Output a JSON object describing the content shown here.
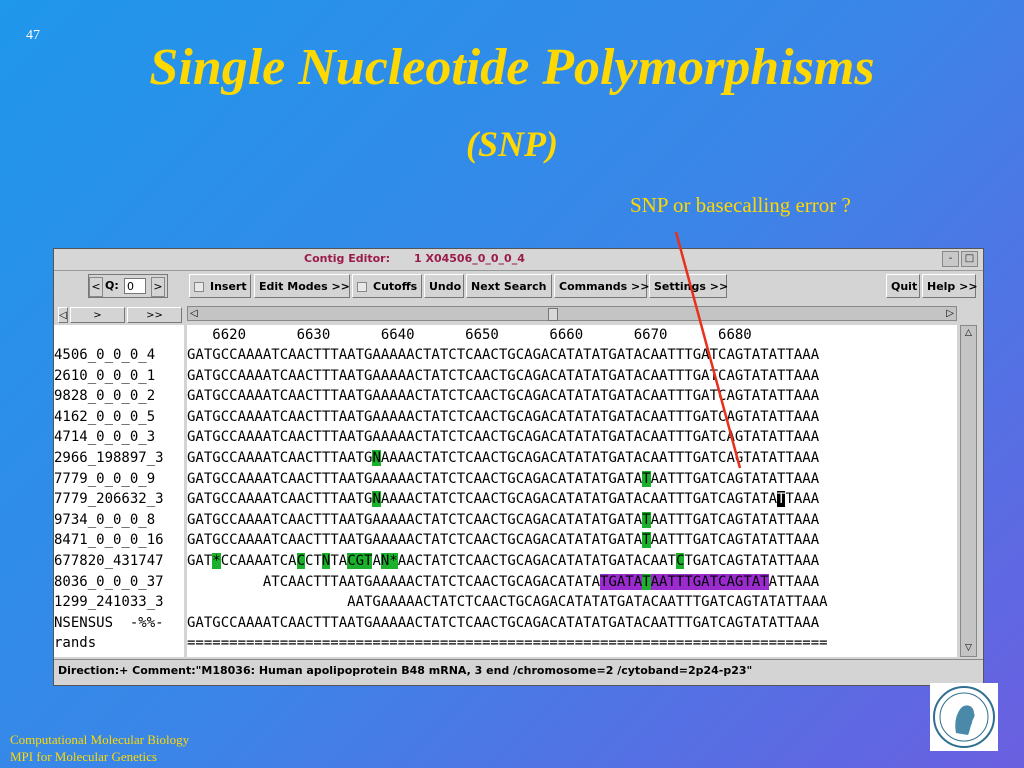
{
  "slide": {
    "number": "47",
    "title": "Single Nucleotide Polymorphisms",
    "subtitle": "(SNP)",
    "annotation": "SNP or basecalling error ?",
    "footer_line1": "Computational Molecular Biology",
    "footer_line2": "MPI for Molecular Genetics",
    "logo_icon": "minerva-head-logo-icon",
    "title_color": "#ffd800",
    "annotation_arrow_color": "#e8301c"
  },
  "window": {
    "title_label": "Contig Editor:",
    "title_name": "1 X04506_0_0_0_4",
    "minimize": "-",
    "close": "□"
  },
  "toolbar": {
    "q_left": "<",
    "q_label": "Q:",
    "q_value": "0",
    "q_right": ">",
    "insert": "Insert",
    "edit_modes": "Edit Modes >>",
    "cutoffs": "Cutoffs",
    "undo": "Undo",
    "next_search": "Next Search",
    "commands": "Commands >>",
    "settings": "Settings >>",
    "quit": "Quit",
    "help": "Help >>"
  },
  "nav": {
    "fwd": ">",
    "ffwd": ">>",
    "back": "◁",
    "left_arrow": "◁",
    "right_arrow": "▷"
  },
  "ruler": "   6620      6630      6640      6650      6660      6670      6680",
  "reads": [
    {
      "name": "4506_0_0_0_4",
      "seq": [
        {
          "t": "GATGCCAAAATCAACTTTAATGAAAAACTATCTCAACTGCAGACATATATGATACAATTTGATCAGTATATTAAA"
        }
      ]
    },
    {
      "name": "2610_0_0_0_1",
      "seq": [
        {
          "t": "GATGCCAAAATCAACTTTAATGAAAAACTATCTCAACTGCAGACATATATGATACAATTTGATCAGTATATTAAA"
        }
      ]
    },
    {
      "name": "9828_0_0_0_2",
      "seq": [
        {
          "t": "GATGCCAAAATCAACTTTAATGAAAAACTATCTCAACTGCAGACATATATGATACAATTTGATCAGTATATTAAA"
        }
      ]
    },
    {
      "name": "4162_0_0_0_5",
      "seq": [
        {
          "t": "GATGCCAAAATCAACTTTAATGAAAAACTATCTCAACTGCAGACATATATGATACAATTTGATCAGTATATTAAA"
        }
      ]
    },
    {
      "name": "4714_0_0_0_3",
      "seq": [
        {
          "t": "GATGCCAAAATCAACTTTAATGAAAAACTATCTCAACTGCAGACATATATGATACAATTTGATCAGTATATTAAA"
        }
      ]
    },
    {
      "name": "2966_198897_3",
      "seq": [
        {
          "t": "GATGCCAAAATCAACTTTAATG"
        },
        {
          "t": "N",
          "h": "g"
        },
        {
          "t": "AAAACTATCTCAACTGCAGACATATATGATACAATTTGATCAGTATATTAAA"
        }
      ]
    },
    {
      "name": "7779_0_0_0_9",
      "seq": [
        {
          "t": "GATGCCAAAATCAACTTTAATGAAAAACTATCTCAACTGCAGACATATATGATA"
        },
        {
          "t": "T",
          "h": "g"
        },
        {
          "t": "AATTTGATCAGTATATTAAA"
        }
      ]
    },
    {
      "name": "7779_206632_3",
      "seq": [
        {
          "t": "GATGCCAAAATCAACTTTAATG"
        },
        {
          "t": "N",
          "h": "g"
        },
        {
          "t": "AAAACTATCTCAACTGCAGACATATATGATACAATTTGATCAGTATA"
        },
        {
          "t": "T",
          "h": "k"
        },
        {
          "t": "TAAA"
        }
      ]
    },
    {
      "name": "9734_0_0_0_8",
      "seq": [
        {
          "t": "GATGCCAAAATCAACTTTAATGAAAAACTATCTCAACTGCAGACATATATGATA"
        },
        {
          "t": "T",
          "h": "g"
        },
        {
          "t": "AATTTGATCAGTATATTAAA"
        }
      ]
    },
    {
      "name": "8471_0_0_0_16",
      "seq": [
        {
          "t": "GATGCCAAAATCAACTTTAATGAAAAACTATCTCAACTGCAGACATATATGATA"
        },
        {
          "t": "T",
          "h": "g"
        },
        {
          "t": "AATTTGATCAGTATATTAAA"
        }
      ]
    },
    {
      "name": "677820_431747",
      "seq": [
        {
          "t": "GAT"
        },
        {
          "t": "*",
          "h": "g"
        },
        {
          "t": "CCAAAATCA"
        },
        {
          "t": "C",
          "h": "g"
        },
        {
          "t": "CT"
        },
        {
          "t": "N",
          "h": "g"
        },
        {
          "t": "TA"
        },
        {
          "t": "CGT",
          "h": "g"
        },
        {
          "t": "A"
        },
        {
          "t": "N*",
          "h": "g"
        },
        {
          "t": "AACTATCTCAACTGCAGACATATATGATACAAT"
        },
        {
          "t": "C",
          "h": "g"
        },
        {
          "t": "TGATCAGTATATTAAA"
        }
      ]
    },
    {
      "name": "8036_0_0_0_37",
      "seq": [
        {
          "t": "         ATCAACTTTAATGAAAAACTATCTCAACTGCAGACATATA"
        },
        {
          "t": "TGATA",
          "h": "p"
        },
        {
          "t": "T",
          "h": "g"
        },
        {
          "t": "AATTTGATCAGTAT",
          "h": "p"
        },
        {
          "t": "ATTAAA"
        }
      ]
    },
    {
      "name": "1299_241033_3",
      "seq": [
        {
          "t": "                   AATGAAAAACTATCTCAACTGCAGACATATATGATACAATTTGATCAGTATATTAAA"
        }
      ]
    },
    {
      "name": "NSENSUS  -%%-",
      "seq": [
        {
          "t": "GATGCCAAAATCAACTTTAATGAAAAACTATCTCAACTGCAGACATATATGATACAATTTGATCAGTATATTAAA"
        }
      ]
    },
    {
      "name": "rands",
      "seq": [
        {
          "t": "============================================================================"
        }
      ]
    }
  ],
  "status": "Direction:+   Comment:\"M18036: Human apolipoprotein B48 mRNA, 3  end /chromosome=2 /cytoband=2p24-p23\"",
  "colors": {
    "highlight_green": "#1cb12c",
    "highlight_purple": "#9b2bcf",
    "highlight_black": "#000000"
  }
}
